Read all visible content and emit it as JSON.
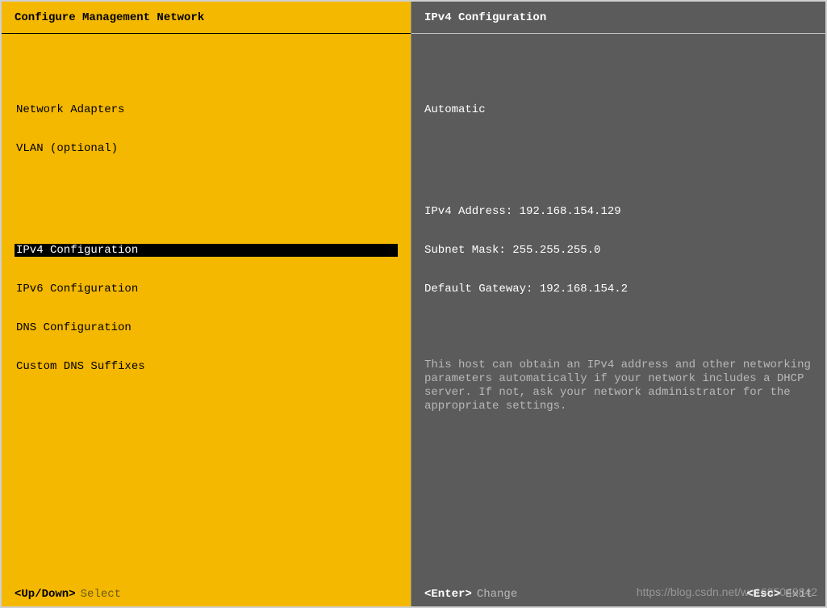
{
  "colors": {
    "accent": "#f4b800",
    "panel": "#5b5b5b",
    "selection": "#000000"
  },
  "left": {
    "title": "Configure Management Network",
    "menu": {
      "group1": [
        "Network Adapters",
        "VLAN (optional)"
      ],
      "group2": [
        "IPv4 Configuration",
        "IPv6 Configuration",
        "DNS Configuration",
        "Custom DNS Suffixes"
      ],
      "selected": "IPv4 Configuration"
    },
    "footer": {
      "key": "<Up/Down>",
      "label": "Select"
    }
  },
  "right": {
    "title": "IPv4 Configuration",
    "mode": "Automatic",
    "fields": {
      "ipv4_label": "IPv4 Address:",
      "ipv4_value": "192.168.154.129",
      "mask_label": "Subnet Mask:",
      "mask_value": "255.255.255.0",
      "gw_label": "Default Gateway:",
      "gw_value": "192.168.154.2"
    },
    "help": "This host can obtain an IPv4 address and other networking parameters automatically if your network includes a DHCP server. If not, ask your network administrator for the appropriate settings.",
    "footer": {
      "enter_key": "<Enter>",
      "enter_label": "Change",
      "esc_key": "<Esc>",
      "esc_label": "Exit"
    }
  },
  "watermark": "https://blog.csdn.net/wc1695040842"
}
